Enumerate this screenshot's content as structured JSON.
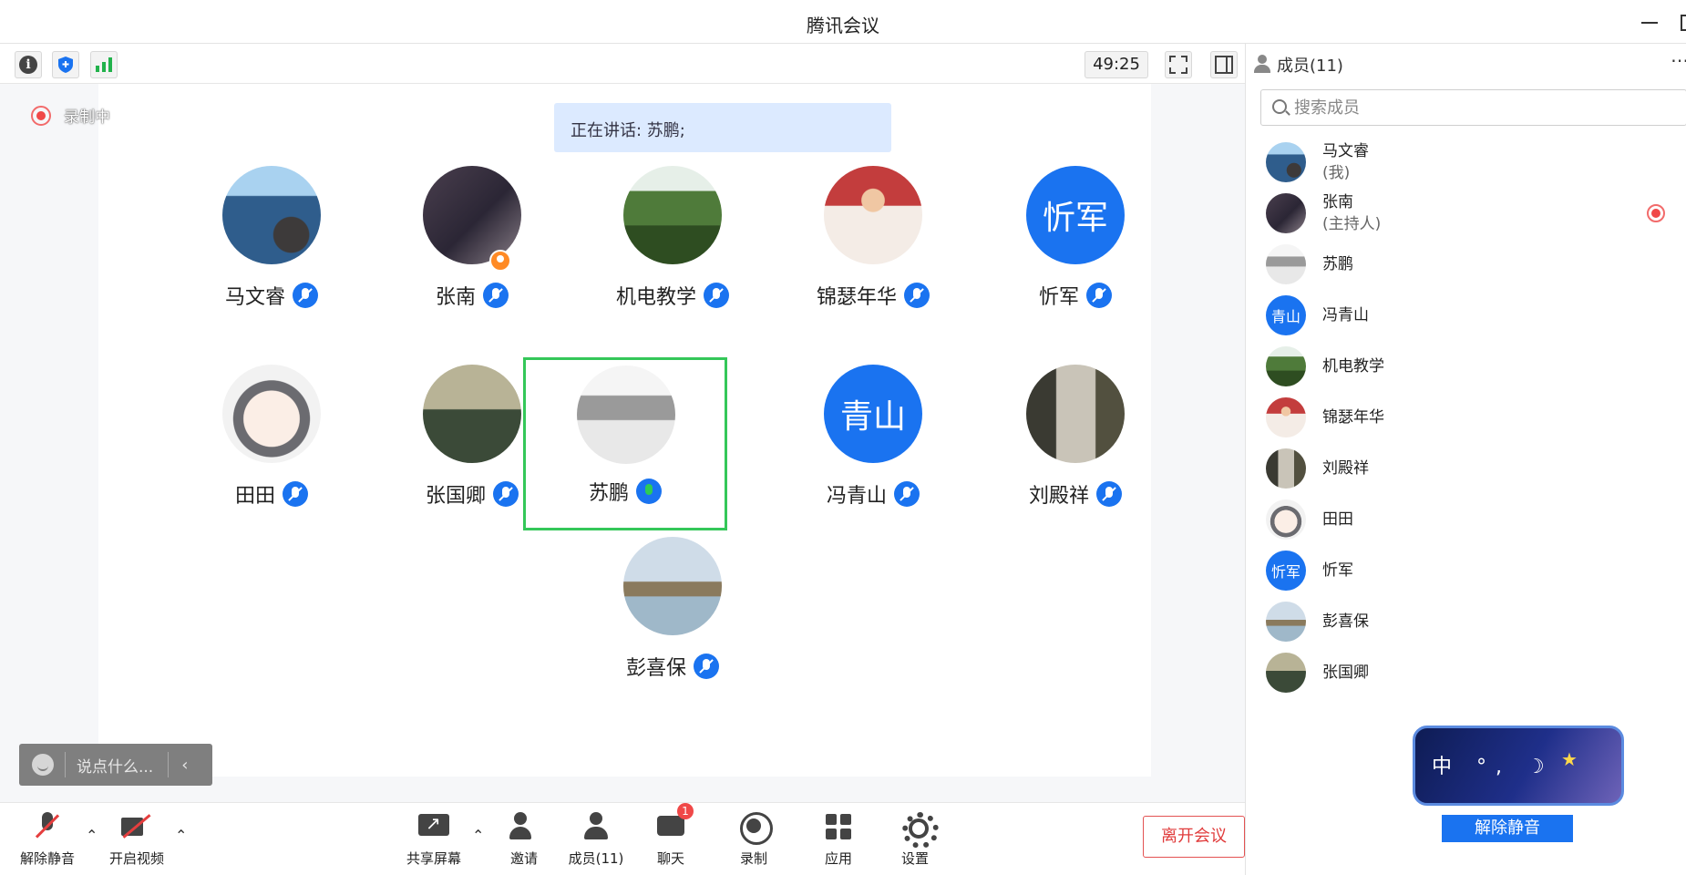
{
  "window": {
    "title": "腾讯会议"
  },
  "topbar": {
    "timer": "49:25"
  },
  "main": {
    "recording_label": "录制中",
    "speaking_text": "正在讲话: 苏鹏;",
    "participants": [
      {
        "name": "马文睿"
      },
      {
        "name": "张南"
      },
      {
        "name": "机电教学"
      },
      {
        "name": "锦瑟年华"
      },
      {
        "name": "忻军",
        "avatar_text": "忻军"
      },
      {
        "name": "田田"
      },
      {
        "name": "张国卿"
      },
      {
        "name": "苏鹏"
      },
      {
        "name": "冯青山",
        "avatar_text": "青山"
      },
      {
        "name": "刘殿祥"
      },
      {
        "name": "彭喜保"
      }
    ],
    "chat_placeholder": "说点什么...",
    "chat_collapse_icon": "chevron-left-icon"
  },
  "bottombar": {
    "unmute_label": "解除静音",
    "video_label": "开启视频",
    "share_label": "共享屏幕",
    "invite_label": "邀请",
    "members_label": "成员(11)",
    "chat_label": "聊天",
    "chat_badge": "1",
    "record_label": "录制",
    "apps_label": "应用",
    "settings_label": "设置",
    "leave_label": "离开会议"
  },
  "right_panel": {
    "title": "成员(11)",
    "search_placeholder": "搜索成员",
    "members": [
      {
        "name": "马文睿",
        "sub": "(我)"
      },
      {
        "name": "张南",
        "sub": "(主持人)"
      },
      {
        "name": "苏鹏"
      },
      {
        "name": "冯青山",
        "avatar_text": "青山"
      },
      {
        "name": "机电教学"
      },
      {
        "name": "锦瑟年华"
      },
      {
        "name": "刘殿祥"
      },
      {
        "name": "田田"
      },
      {
        "name": "忻军",
        "avatar_text": "忻军"
      },
      {
        "name": "彭喜保"
      },
      {
        "name": "张国卿"
      }
    ],
    "ime_text": "中 °, ☽",
    "unmute_button": "解除静音"
  },
  "colors": {
    "accent": "#1a73f0",
    "leave": "#e03b3b",
    "highlight": "#34c759",
    "recording": "#f04848"
  }
}
